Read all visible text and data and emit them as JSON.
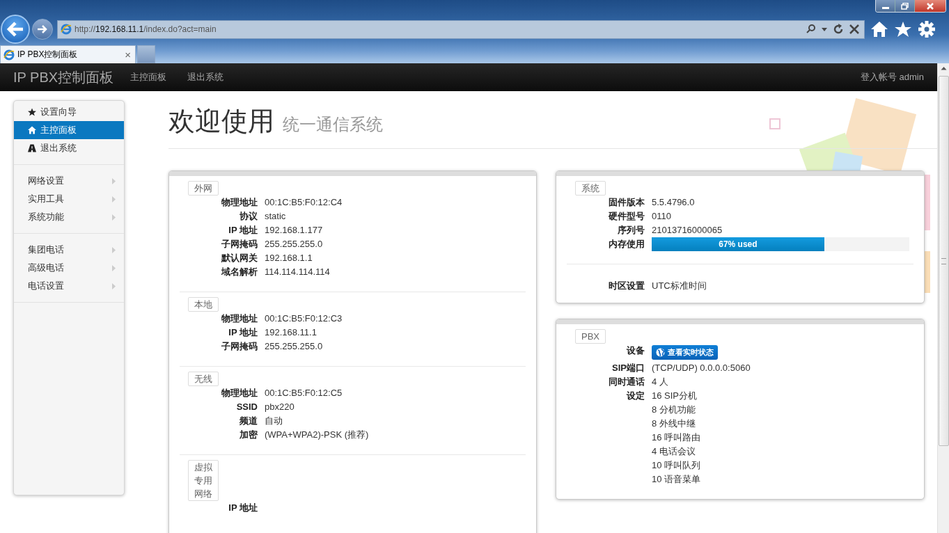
{
  "browser": {
    "url_prefix": "http://",
    "url_host": "192.168.11.1",
    "url_path": "/index.do?act=main",
    "tab_title": "IP PBX控制面板",
    "tab_close": "×"
  },
  "navbar": {
    "brand": "IP PBX控制面板",
    "links": [
      {
        "label": "主控面板",
        "selected": false
      },
      {
        "label": "退出系统",
        "selected": false
      }
    ],
    "account": "登入帐号 admin"
  },
  "sidebar": {
    "groups": [
      [
        {
          "label": "设置向导",
          "selected": false,
          "submenu": false
        },
        {
          "label": "主控面板",
          "selected": true,
          "submenu": false
        },
        {
          "label": "退出系统",
          "selected": false,
          "submenu": false
        }
      ],
      [
        {
          "label": "网络设置",
          "selected": false,
          "submenu": true
        },
        {
          "label": "实用工具",
          "selected": false,
          "submenu": true
        },
        {
          "label": "系统功能",
          "selected": false,
          "submenu": true
        }
      ],
      [
        {
          "label": "集团电话",
          "selected": false,
          "submenu": true
        },
        {
          "label": "高级电话",
          "selected": false,
          "submenu": true
        },
        {
          "label": "电话设置",
          "selected": false,
          "submenu": true
        }
      ]
    ]
  },
  "heading": {
    "title": "欢迎使用",
    "subtitle": "统一通信系统"
  },
  "network_panel": {
    "sections": [
      {
        "legend": "外网",
        "rows": [
          {
            "label": "物理地址",
            "value": "00:1C:B5:F0:12:C4"
          },
          {
            "label": "协议",
            "value": "static"
          },
          {
            "label": "IP 地址",
            "value": "192.168.1.177"
          },
          {
            "label": "子网掩码",
            "value": "255.255.255.0"
          },
          {
            "label": "默认网关",
            "value": "192.168.1.1"
          },
          {
            "label": "域名解析",
            "value": "114.114.114.114"
          }
        ]
      },
      {
        "legend": "本地",
        "rows": [
          {
            "label": "物理地址",
            "value": "00:1C:B5:F0:12:C3"
          },
          {
            "label": "IP 地址",
            "value": "192.168.11.1"
          },
          {
            "label": "子网掩码",
            "value": "255.255.255.0"
          }
        ]
      },
      {
        "legend": "无线",
        "rows": [
          {
            "label": "物理地址",
            "value": "00:1C:B5:F0:12:C5"
          },
          {
            "label": "SSID",
            "value": "pbx220"
          },
          {
            "label": "频道",
            "value": "自动"
          },
          {
            "label": "加密",
            "value": "(WPA+WPA2)-PSK (推荐)"
          }
        ]
      },
      {
        "legend": "虚拟专用网络",
        "rows": [
          {
            "label": "IP 地址"
          }
        ]
      }
    ]
  },
  "system_panel": {
    "legend": "系统",
    "sections": [
      {
        "rows": [
          {
            "kind": "text",
            "label": "固件版本",
            "value": "5.5.4796.0"
          },
          {
            "kind": "text",
            "label": "硬件型号",
            "value": "0110"
          },
          {
            "kind": "text",
            "label": "序列号",
            "value": "21013716000065"
          },
          {
            "kind": "progress",
            "label": "内存使用",
            "level": 0.67,
            "reading": "67% used"
          }
        ]
      },
      {
        "rows": [
          {
            "kind": "text",
            "label": "时区设置",
            "value": "UTC标准时间"
          }
        ]
      }
    ]
  },
  "pbx_panel": {
    "legend": "PBX",
    "rows": [
      {
        "kind": "button",
        "label": "设备",
        "value": "查看实时状态"
      },
      {
        "kind": "text",
        "label": "SIP端口",
        "value": "(TCP/UDP) 0.0.0.0:5060"
      },
      {
        "kind": "text",
        "label": "同时通话",
        "value": "4 人"
      },
      {
        "kind": "list",
        "label": "设定",
        "values": [
          "16 SIP分机",
          "8 分机功能",
          "8 外线中继",
          "16 呼叫路由",
          "4 电话会议",
          "10 呼叫队列",
          "10 语音菜单"
        ]
      }
    ]
  }
}
